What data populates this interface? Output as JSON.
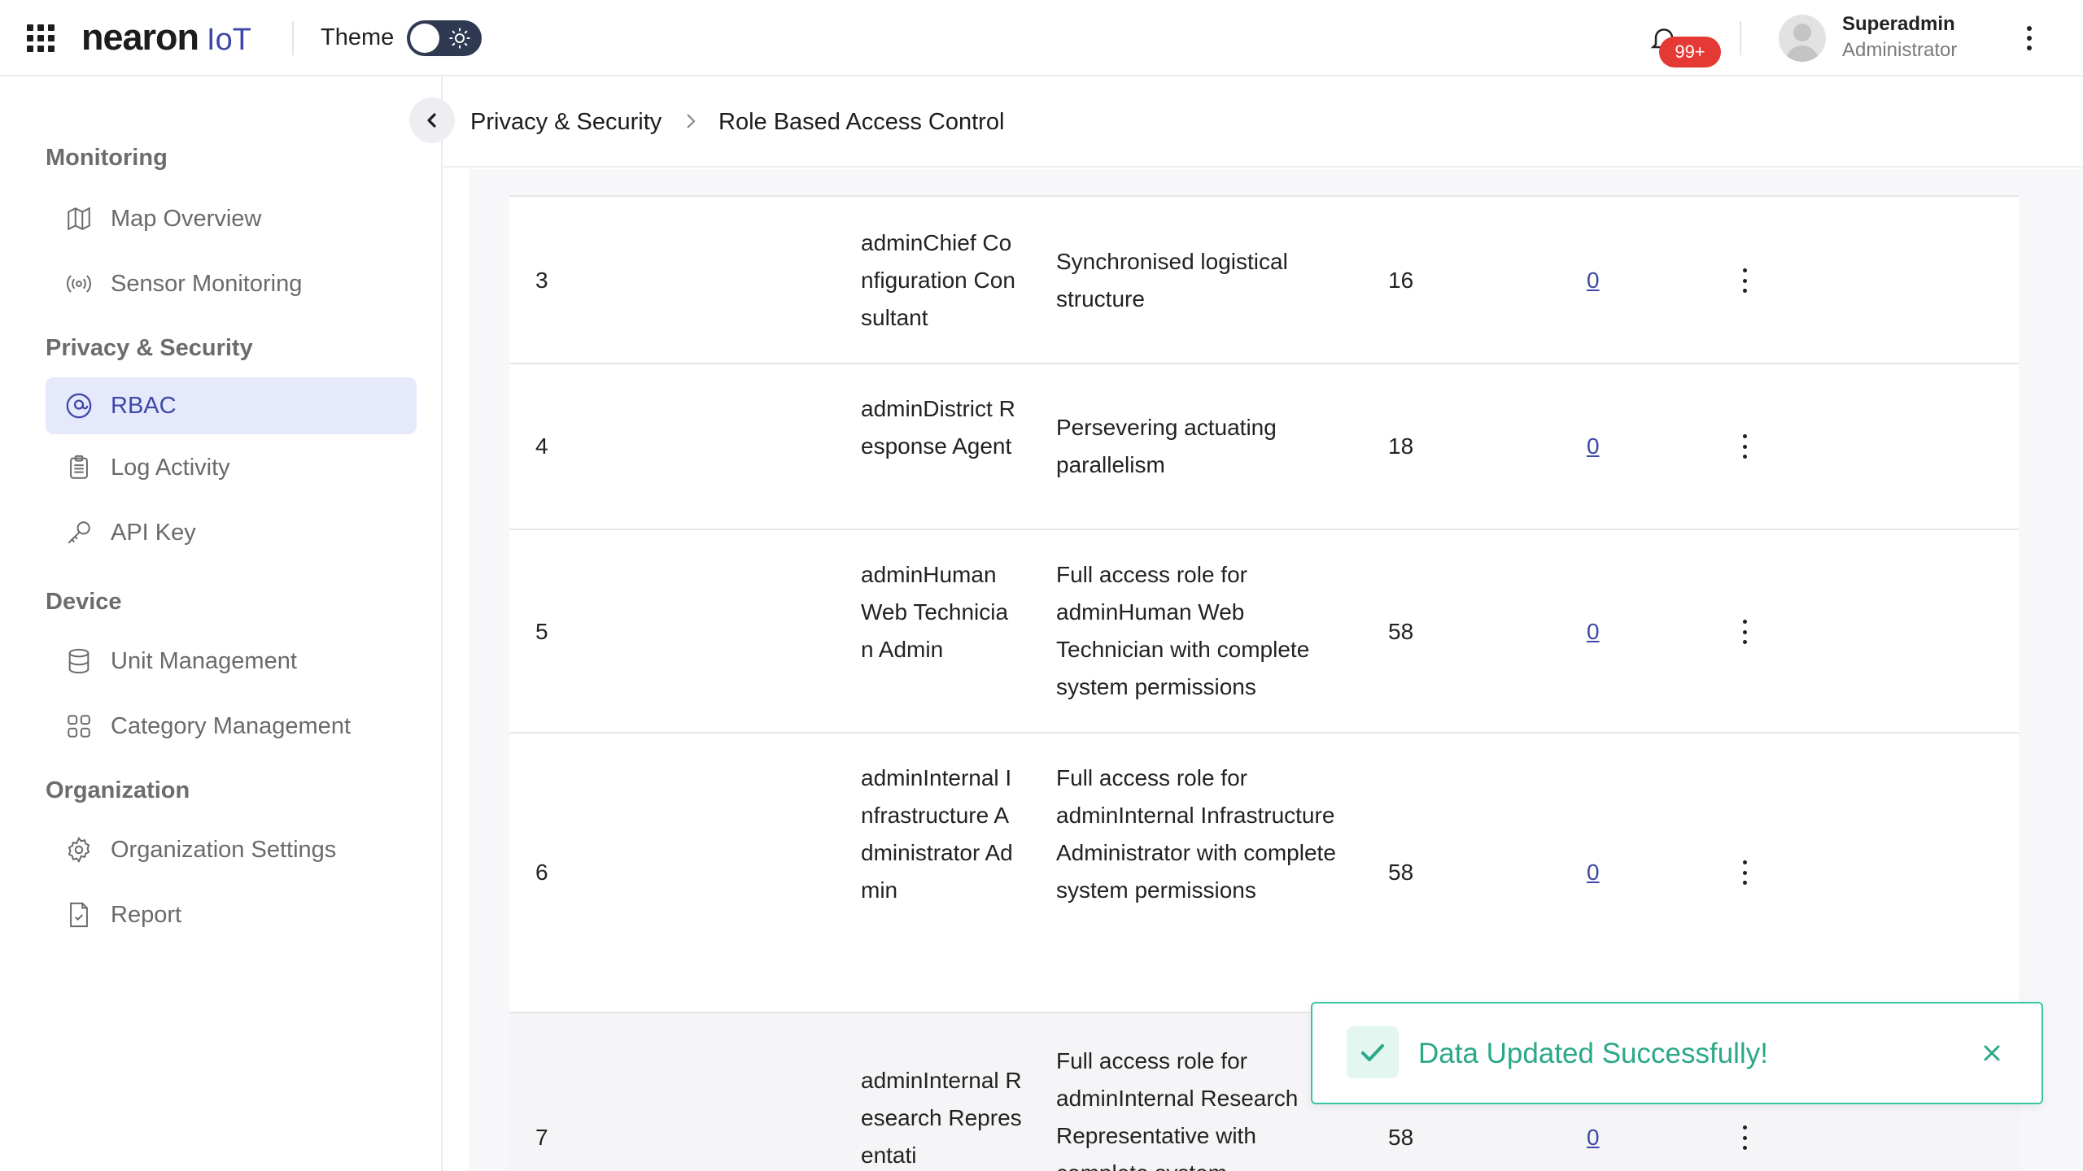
{
  "header": {
    "logo_main": "nearon",
    "logo_suffix": "IoT",
    "theme_label": "Theme",
    "notification_count": "99+",
    "user": {
      "name": "Superadmin",
      "role": "Administrator"
    }
  },
  "sidebar": {
    "sections": [
      {
        "title": "Monitoring",
        "items": [
          {
            "label": "Map Overview",
            "icon": "map-icon"
          },
          {
            "label": "Sensor Monitoring",
            "icon": "broadcast-icon"
          }
        ]
      },
      {
        "title": "Privacy & Security",
        "items": [
          {
            "label": "RBAC",
            "icon": "rbac-icon",
            "active": true
          },
          {
            "label": "Log Activity",
            "icon": "clipboard-icon"
          },
          {
            "label": "API Key",
            "icon": "key-icon"
          }
        ]
      },
      {
        "title": "Device",
        "items": [
          {
            "label": "Unit Management",
            "icon": "database-icon"
          },
          {
            "label": "Category Management",
            "icon": "grid-icon"
          }
        ]
      },
      {
        "title": "Organization",
        "items": [
          {
            "label": "Organization Settings",
            "icon": "gear-icon"
          },
          {
            "label": "Report",
            "icon": "report-icon"
          }
        ]
      }
    ]
  },
  "breadcrumb": {
    "parent": "Privacy & Security",
    "current": "Role Based Access Control"
  },
  "table": {
    "rows": [
      {
        "no": "3",
        "name": "adminChief Configuration Consultant",
        "description": "Synchronised logistical structure",
        "count": "16",
        "link": "0"
      },
      {
        "no": "4",
        "name": "adminDistrict Response Agent",
        "description": "Persevering actuating parallelism",
        "count": "18",
        "link": "0"
      },
      {
        "no": "5",
        "name": "adminHuman Web Technician Admin",
        "description": "Full access role for adminHuman Web Technician with complete system permissions",
        "count": "58",
        "link": "0"
      },
      {
        "no": "6",
        "name": "adminInternal Infrastructure Administrator Admin",
        "description": "Full access role for adminInternal Infrastructure Administrator with complete system permissions",
        "count": "58",
        "link": "0"
      },
      {
        "no": "7",
        "name": "adminInternal Research Representati",
        "description": "Full access role for adminInternal Research Representative with complete system",
        "count": "58",
        "link": "0"
      }
    ]
  },
  "toast": {
    "message": "Data Updated Successfully!",
    "status_color": "#2aa887"
  },
  "colors": {
    "accent": "#3d48a8",
    "active_bg": "#e6e8fb",
    "badge": "#e53935"
  }
}
